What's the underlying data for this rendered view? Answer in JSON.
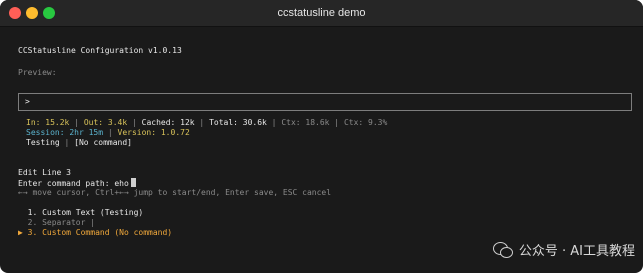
{
  "window": {
    "title": "ccstatusline demo"
  },
  "header": {
    "app_title": "CCStatusline Configuration v1.0.13",
    "preview_label": "Preview:",
    "prompt_symbol": ">"
  },
  "status": {
    "in": "In: 15.2k",
    "out": "Out: 3.4k",
    "cached": "Cached: 12k",
    "total": "Total: 30.6k",
    "ctx1": "Ctx: 18.6k",
    "ctx2": "Ctx: 9.3%",
    "separator": " | ",
    "session": "Session: 2hr 15m",
    "version": "Version: 1.0.72",
    "custom_text": "Testing",
    "custom_command": "[No command]"
  },
  "editor": {
    "heading": "Edit Line 3",
    "prompt_label": "Enter command path: ",
    "input_value": "eho",
    "help": "←→ move cursor, Ctrl+←→ jump to start/end, Enter save, ESC cancel"
  },
  "items": [
    {
      "text": "  1. Custom Text (Testing)"
    },
    {
      "text": "  2. Separator |"
    },
    {
      "text": "▶ 3. Custom Command (No command)"
    }
  ],
  "watermark": {
    "text": "公众号 · AI工具教程"
  },
  "colors": {
    "background": "#1a1a1a",
    "yellow": "#d9c35a",
    "cyan": "#5bb4cf",
    "selected": "#f2a93b",
    "dim": "#8a8a8a"
  }
}
